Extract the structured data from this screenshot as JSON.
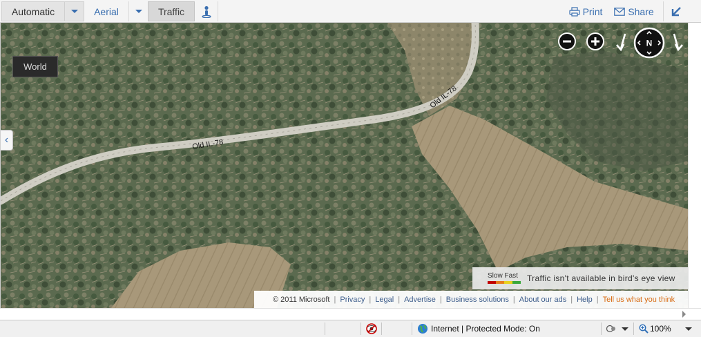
{
  "toolbar": {
    "automatic_label": "Automatic",
    "aerial_label": "Aerial",
    "traffic_label": "Traffic",
    "print_label": "Print",
    "share_label": "Share",
    "accent_color": "#3a6fb0"
  },
  "map": {
    "world_label": "World",
    "roads": [
      {
        "name": "Old IL-78"
      },
      {
        "name": "Old IL-78"
      }
    ],
    "compass_label": "N"
  },
  "traffic_legend": {
    "slow_label": "Slow",
    "fast_label": "Fast",
    "colors": [
      "#c00000",
      "#e87d1e",
      "#e8d21e",
      "#3aa83a"
    ],
    "message": "Traffic isn't available in bird's eye view"
  },
  "footer": {
    "copyright": "© 2011 Microsoft",
    "links": [
      "Privacy",
      "Legal",
      "Advertise",
      "Business solutions",
      "About our ads",
      "Help"
    ],
    "feedback": "Tell us what you think"
  },
  "statusbar": {
    "zone": "Internet | Protected Mode: On",
    "zoom": "100%"
  }
}
